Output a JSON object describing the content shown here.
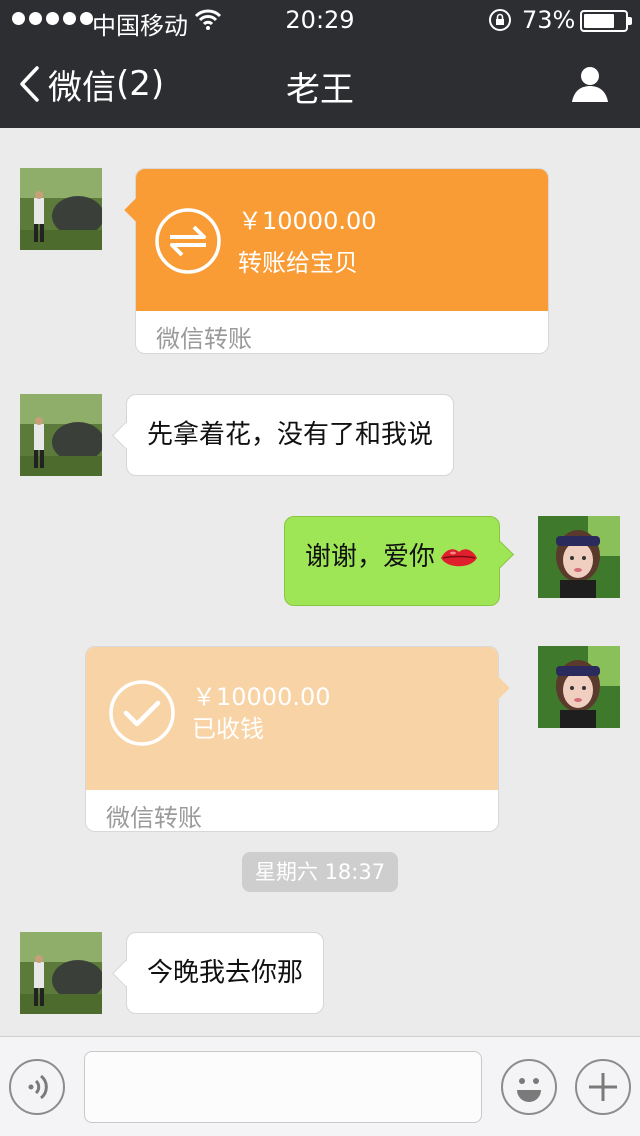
{
  "status_bar": {
    "carrier": "中国移动",
    "time": "20:29",
    "battery_percent": "73%",
    "battery_level": 0.73
  },
  "nav": {
    "back_label": "微信",
    "unread_count": "(2)",
    "title": "老王",
    "profile_icon": "person-icon"
  },
  "messages": [
    {
      "type": "transfer",
      "side": "left",
      "amount": "￥10000.00",
      "description": "转账给宝贝",
      "footer": "微信转账",
      "color": "#f99c36",
      "icon": "transfer-arrows-icon"
    },
    {
      "type": "text",
      "side": "left",
      "text": "先拿着花，没有了和我说"
    },
    {
      "type": "text",
      "side": "right",
      "text": "谢谢，爱你",
      "emoji": "lips-icon"
    },
    {
      "type": "transfer",
      "side": "right",
      "amount": "￥10000.00",
      "description": "已收钱",
      "footer": "微信转账",
      "color": "#f8d3a5",
      "icon": "check-circle-icon"
    },
    {
      "type": "timestamp",
      "text": "星期六 18:37"
    },
    {
      "type": "text",
      "side": "left",
      "text": "今晚我去你那"
    }
  ],
  "input_bar": {
    "voice_icon": "voice-icon",
    "text_value": "",
    "emoji_icon": "emoji-icon",
    "more_icon": "plus-icon"
  },
  "colors": {
    "nav_bg": "#2d2e32",
    "chat_bg": "#ebebeb",
    "sent_bubble": "#9fe656",
    "received_bubble": "#ffffff"
  }
}
